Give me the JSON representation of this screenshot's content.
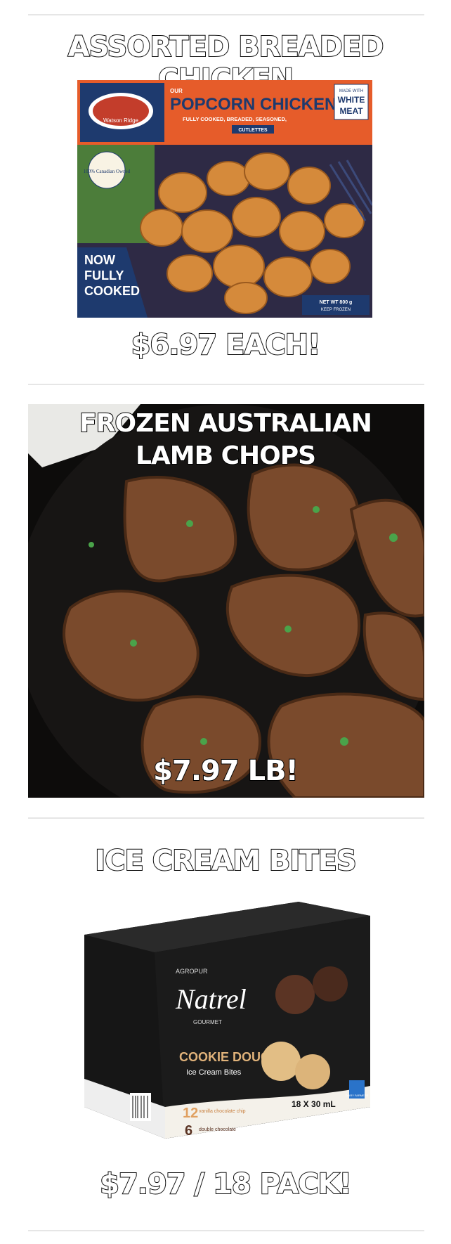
{
  "deals": [
    {
      "title": "ASSORTED BREADED CHICKEN",
      "price": "$6.97 EACH!",
      "product": {
        "brand": "Watson Ridge",
        "our": "OUR",
        "name": "POPCORN CHICKEN",
        "sub": "FULLY COOKED, BREADED, SEASONED,",
        "sub2": "CUTLETTES",
        "badge_line1": "MADE WITH",
        "badge_line2": "WHITE",
        "badge_line3": "MEAT",
        "canadian": "100% Canadian Owned",
        "now1": "NOW",
        "now2": "FULLY",
        "now3": "COOKED",
        "netwt": "NET WT 800 g",
        "keep": "KEEP FROZEN"
      }
    },
    {
      "title_line1": "FROZEN AUSTRALIAN",
      "title_line2": "LAMB CHOPS",
      "price": "$7.97 LB!"
    },
    {
      "title": "ICE CREAM BITES",
      "price": "$7.97 / 18 PACK!",
      "product": {
        "maker": "AGROPUR",
        "brand": "Natrel",
        "gourmet": "GOURMET",
        "name1": "COOKIE DOUGH",
        "name2": "Ice Cream Bites",
        "count1": "12",
        "count1_label": "vanilla chocolate chip",
        "count2": "6",
        "count2_label": "double chocolate",
        "size": "18 X 30 mL",
        "dairy": "DAIRY FARMERS"
      }
    }
  ],
  "colors": {
    "rule": "#e6e6e6",
    "headline_fill": "#ffffff",
    "headline_stroke": "#111111"
  }
}
